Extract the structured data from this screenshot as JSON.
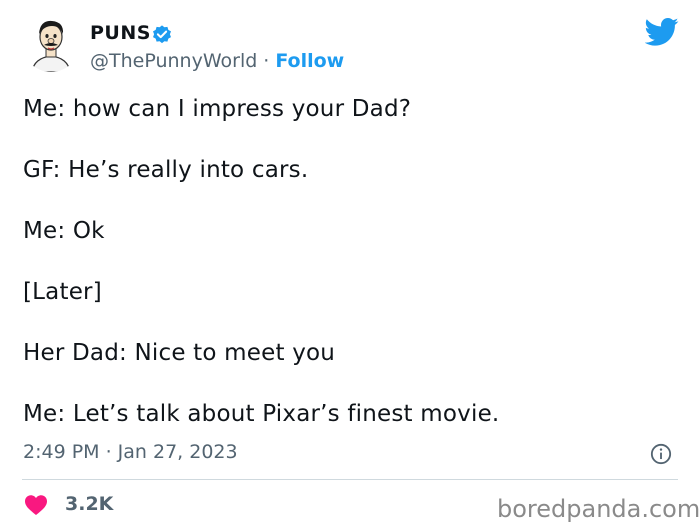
{
  "author": {
    "name": "PUNS",
    "handle": "@ThePunnyWorld",
    "separator": "·",
    "follow_label": "Follow",
    "verified": true,
    "avatar_icon": "cartoon-avatar"
  },
  "tweet": {
    "lines": [
      "Me: how can I impress your Dad?",
      "GF: He’s really into cars.",
      "Me: Ok",
      "[Later]",
      "Her Dad: Nice to meet you",
      "Me: Let’s talk about Pixar’s finest movie."
    ],
    "timestamp": "2:49 PM · Jan 27, 2023"
  },
  "engagement": {
    "likes": "3.2K"
  },
  "watermark": "boredpanda.com",
  "colors": {
    "accent": "#1d9bf0",
    "heart": "#f91880",
    "text": "#0f1419",
    "secondary": "#536471",
    "divider": "#cfd9de"
  }
}
